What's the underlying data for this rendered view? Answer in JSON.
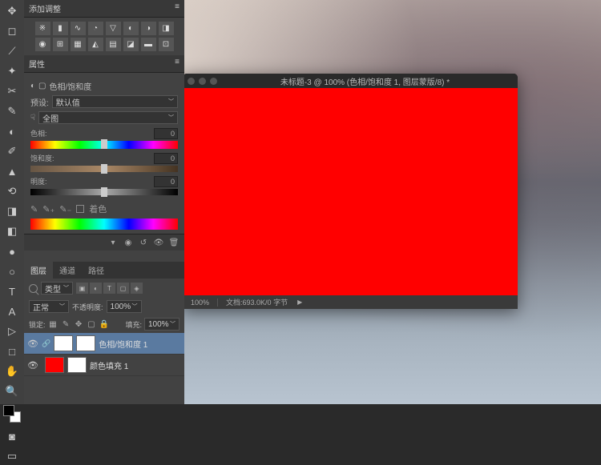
{
  "adjustments_panel": {
    "title": "添加调整"
  },
  "properties_panel": {
    "title": "属性",
    "type_label": "色相/饱和度",
    "preset_label": "预设:",
    "preset_value": "默认值",
    "range_value": "全图",
    "hue": {
      "label": "色相:",
      "value": "0"
    },
    "saturation": {
      "label": "饱和度:",
      "value": "0"
    },
    "lightness": {
      "label": "明度:",
      "value": "0"
    },
    "colorize_label": "着色"
  },
  "layers_panel": {
    "tabs": [
      "图层",
      "通道",
      "路径"
    ],
    "kind_label": "类型",
    "blend_mode": "正常",
    "opacity_label": "不透明度:",
    "opacity_value": "100%",
    "lock_label": "锁定:",
    "fill_label": "填充:",
    "fill_value": "100%",
    "layers": [
      {
        "name": "色相/饱和度 1",
        "thumb_color": "#ffffff"
      },
      {
        "name": "颜色填充 1",
        "thumb_color": "#ff0000"
      }
    ]
  },
  "document": {
    "title": "未标题-3 @ 100% (色相/饱和度 1, 图层蒙版/8) *",
    "zoom": "100%",
    "info": "文档:693.0K/0 字节"
  }
}
